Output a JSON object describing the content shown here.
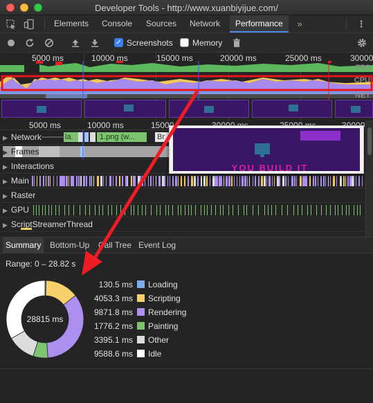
{
  "window": {
    "title": "Developer Tools - http://www.xuanbiyijue.com/"
  },
  "tabs": [
    "Elements",
    "Console",
    "Sources",
    "Network",
    "Performance"
  ],
  "toolbar": {
    "screenshots_label": "Screenshots",
    "memory_label": "Memory"
  },
  "overview": {
    "ticks": [
      "5000 ms",
      "10000 ms",
      "15000 ms",
      "20000 ms",
      "25000 ms",
      "30000"
    ],
    "lanes": [
      "FPS",
      "CPU",
      "NET"
    ]
  },
  "detail_ruler": {
    "ticks": [
      "5000 ms",
      "10000 ms",
      "15000",
      "30000 ms",
      "25000 ms",
      "30000"
    ]
  },
  "tracks": {
    "network": "Network",
    "network_items": [
      "la.",
      "1.png (w...",
      "Br"
    ],
    "frames": "Frames",
    "interactions": "Interactions",
    "main": "Main",
    "raster": "Raster",
    "gpu": "GPU",
    "script_streamer": "ScriptStreamerThread"
  },
  "popup": {
    "banner_text": "YOU BUILD IT"
  },
  "bottom_tabs": [
    "Summary",
    "Bottom-Up",
    "Call Tree",
    "Event Log"
  ],
  "summary": {
    "range": "Range: 0 – 28.82 s",
    "total": "28815 ms",
    "items": [
      {
        "value": "130.5 ms",
        "name": "Loading",
        "color": "#7eadeb",
        "ms": 130.5
      },
      {
        "value": "4053.3 ms",
        "name": "Scripting",
        "color": "#f7d06b",
        "ms": 4053.3
      },
      {
        "value": "9871.8 ms",
        "name": "Rendering",
        "color": "#ad8ff0",
        "ms": 9871.8
      },
      {
        "value": "1776.2 ms",
        "name": "Painting",
        "color": "#7cc46f",
        "ms": 1776.2
      },
      {
        "value": "3395.1 ms",
        "name": "Other",
        "color": "#dcdcdc",
        "ms": 3395.1
      },
      {
        "value": "9588.6 ms",
        "name": "Idle",
        "color": "#ffffff",
        "ms": 9588.6
      }
    ]
  }
}
